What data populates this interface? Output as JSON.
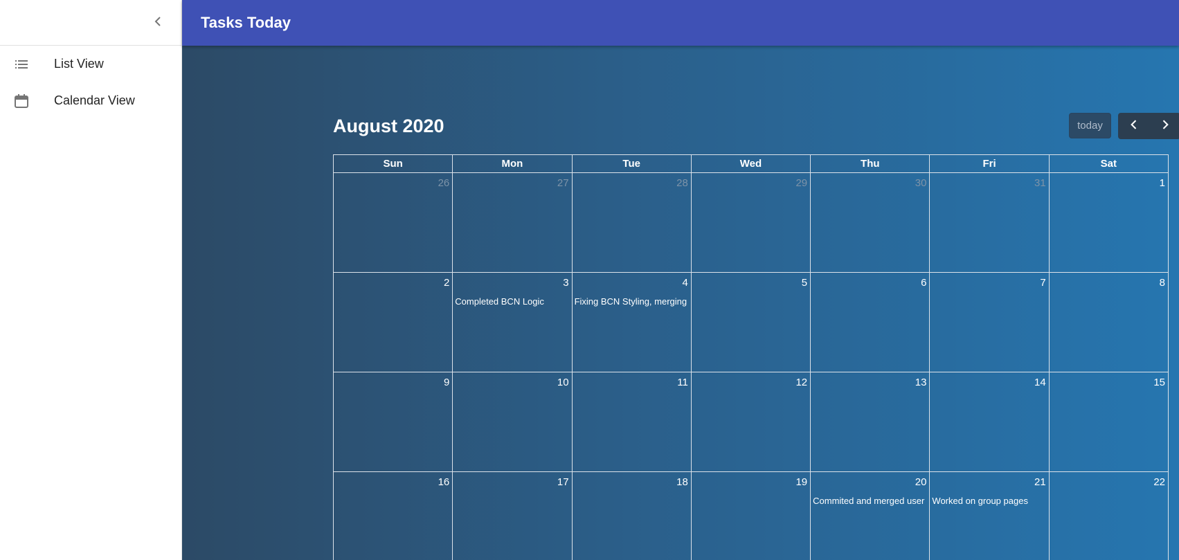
{
  "app": {
    "title": "Tasks Today"
  },
  "sidebar": {
    "collapse_icon": "chevron-left-icon",
    "items": [
      {
        "label": "List View",
        "icon": "list-icon"
      },
      {
        "label": "Calendar View",
        "icon": "calendar-icon"
      }
    ]
  },
  "calendar": {
    "title": "August 2020",
    "today_label": "today",
    "prev_icon": "chevron-left-icon",
    "next_icon": "chevron-right-icon",
    "weekdays": [
      "Sun",
      "Mon",
      "Tue",
      "Wed",
      "Thu",
      "Fri",
      "Sat"
    ],
    "weeks": [
      [
        {
          "day": "26",
          "other": true
        },
        {
          "day": "27",
          "other": true
        },
        {
          "day": "28",
          "other": true
        },
        {
          "day": "29",
          "other": true
        },
        {
          "day": "30",
          "other": true
        },
        {
          "day": "31",
          "other": true
        },
        {
          "day": "1"
        }
      ],
      [
        {
          "day": "2"
        },
        {
          "day": "3",
          "event": "Completed BCN Logic"
        },
        {
          "day": "4",
          "event": "Fixing BCN Styling, merging"
        },
        {
          "day": "5"
        },
        {
          "day": "6"
        },
        {
          "day": "7"
        },
        {
          "day": "8"
        }
      ],
      [
        {
          "day": "9"
        },
        {
          "day": "10"
        },
        {
          "day": "11"
        },
        {
          "day": "12"
        },
        {
          "day": "13"
        },
        {
          "day": "14"
        },
        {
          "day": "15"
        }
      ],
      [
        {
          "day": "16"
        },
        {
          "day": "17"
        },
        {
          "day": "18"
        },
        {
          "day": "19"
        },
        {
          "day": "20",
          "event": "Commited and merged user"
        },
        {
          "day": "21",
          "event": "Worked on group pages"
        },
        {
          "day": "22"
        }
      ]
    ]
  },
  "colors": {
    "appbar": "#3f51b5",
    "nav_group": "#2c3e50",
    "grid_line": "#dde3ea"
  }
}
